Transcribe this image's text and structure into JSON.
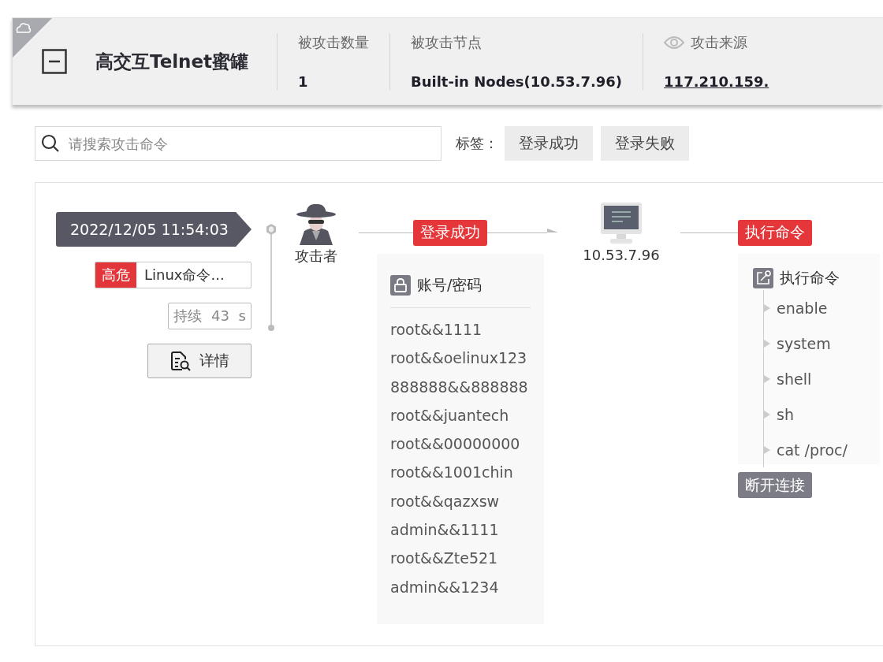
{
  "header": {
    "title": "高交互Telnet蜜罐",
    "stats": [
      {
        "kind": "plain",
        "label": "被攻击数量",
        "value": "1"
      },
      {
        "kind": "plain",
        "label": "被攻击节点",
        "value": "Built-in Nodes(10.53.7.96)"
      },
      {
        "kind": "link",
        "label": "攻击来源",
        "value": "117.210.159."
      }
    ]
  },
  "search": {
    "placeholder": "请搜索攻击命令"
  },
  "tags": {
    "label": "标签：",
    "options": [
      "登录成功",
      "登录失败"
    ]
  },
  "event": {
    "time": "2022/12/05 11:54:03",
    "severity": "高危",
    "category": "Linux命令...",
    "duration": "持续 43 s",
    "details_button": "详情"
  },
  "flow": {
    "attacker": "攻击者",
    "login_edge": "登录成功",
    "credentials": {
      "title": "账号/密码",
      "items": [
        "root&&1111",
        "root&&oelinux123",
        "888888&&888888",
        "root&&juantech",
        "root&&00000000",
        "root&&1001chin",
        "root&&qazxsw",
        "admin&&1111",
        "root&&Zte521",
        "admin&&1234"
      ]
    },
    "target": "10.53.7.96",
    "exec_edge": "执行命令",
    "commands": {
      "title": "执行命令",
      "items": [
        "enable",
        "system",
        "shell",
        "sh",
        "cat /proc/"
      ]
    },
    "end_edge": "断开连接"
  }
}
